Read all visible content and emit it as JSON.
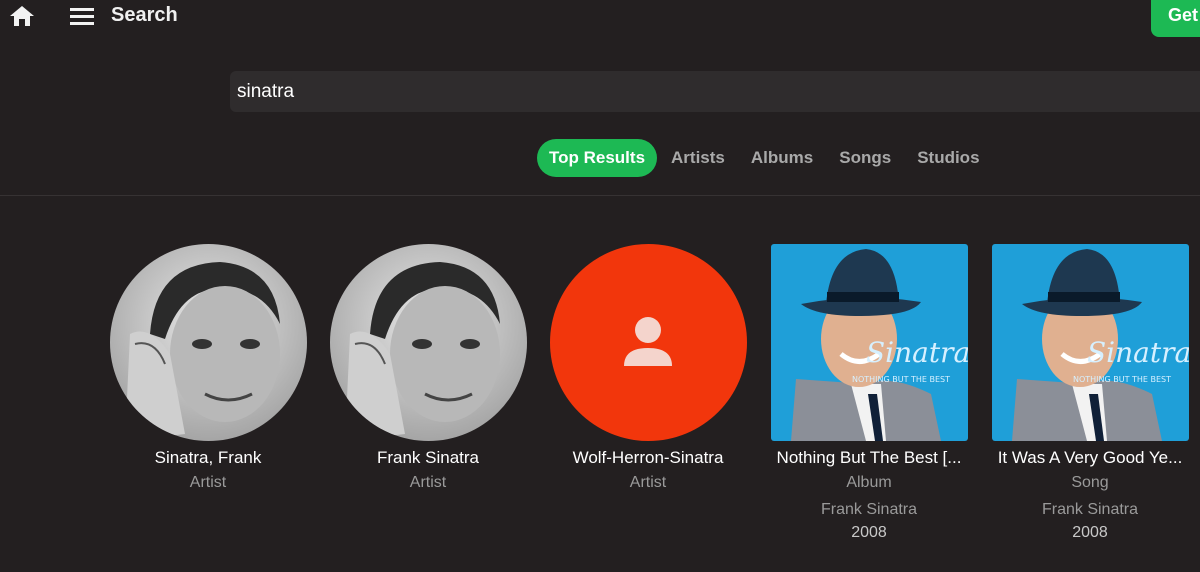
{
  "header": {
    "title": "Search",
    "home_icon": "home-icon",
    "menu_icon": "hamburger-menu-icon",
    "get_button_label": "Get",
    "accent_color": "#1db954"
  },
  "search": {
    "value": "sinatra"
  },
  "tabs": [
    {
      "label": "Top Results",
      "active": true
    },
    {
      "label": "Artists",
      "active": false
    },
    {
      "label": "Albums",
      "active": false
    },
    {
      "label": "Songs",
      "active": false
    },
    {
      "label": "Studios",
      "active": false
    }
  ],
  "results": [
    {
      "title": "Sinatra, Frank",
      "type": "Artist"
    },
    {
      "title": "Frank Sinatra",
      "type": "Artist"
    },
    {
      "title": "Wolf-Herron-Sinatra",
      "type": "Artist",
      "placeholder_icon": "person-icon",
      "placeholder_color": "#f2360c"
    },
    {
      "title": "Nothing But The Best [...",
      "type": "Album",
      "artist": "Frank Sinatra",
      "year": "2008",
      "cover_text": {
        "name": "Sinatra",
        "tagline": "NOTHING BUT THE BEST"
      }
    },
    {
      "title": "It Was A Very Good Ye...",
      "type": "Song",
      "artist": "Frank Sinatra",
      "year": "2008",
      "cover_text": {
        "name": "Sinatra",
        "tagline": "NOTHING BUT THE BEST"
      }
    }
  ]
}
